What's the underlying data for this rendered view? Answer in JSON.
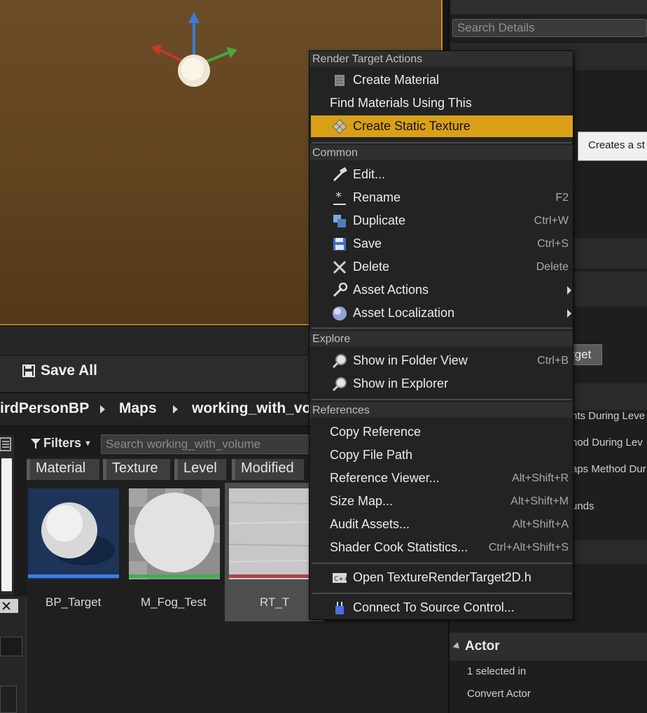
{
  "details": {
    "search_placeholder": "Search Details",
    "tooltip_text": "Creates a st",
    "partial_rows": [
      "e",
      "'",
      "nts During Leve",
      "hod During Lev",
      "aps Method Dur",
      "unds"
    ],
    "target_button": "rget",
    "actor_section": "Actor",
    "actor_selected": "1 selected in",
    "convert_actor": "Convert Actor"
  },
  "content_browser": {
    "save_all": "Save All",
    "breadcrumbs": [
      "irdPersonBP",
      "Maps",
      "working_with_vol"
    ],
    "filters_label": "Filters",
    "search_placeholder": "Search working_with_volume",
    "filter_chips": [
      "Material",
      "Texture",
      "Level",
      "Modified"
    ],
    "assets": [
      {
        "name": "BP_Target",
        "type_color": "#3d7ee6"
      },
      {
        "name": "M_Fog_Test",
        "type_color": "#3fb24a"
      },
      {
        "name": "RT_T",
        "type_color": "#b04545"
      }
    ]
  },
  "context_menu": {
    "sections": {
      "render_target": "Render Target Actions",
      "common": "Common",
      "explore": "Explore",
      "references": "References"
    },
    "render_target_items": [
      {
        "label": "Create Material",
        "icon": "material-icon"
      },
      {
        "label": "Find Materials Using This"
      },
      {
        "label": "Create Static Texture",
        "icon": "texture-icon",
        "highlighted": true
      }
    ],
    "common_items": [
      {
        "label": "Edit...",
        "icon": "edit-icon",
        "shortcut": ""
      },
      {
        "label": "Rename",
        "icon": "rename-icon",
        "shortcut": "F2"
      },
      {
        "label": "Duplicate",
        "icon": "duplicate-icon",
        "shortcut": "Ctrl+W"
      },
      {
        "label": "Save",
        "icon": "save-icon",
        "shortcut": "Ctrl+S"
      },
      {
        "label": "Delete",
        "icon": "delete-icon",
        "shortcut": "Delete"
      },
      {
        "label": "Asset Actions",
        "icon": "wrench-icon",
        "submenu": true
      },
      {
        "label": "Asset Localization",
        "icon": "globe-icon",
        "submenu": true
      }
    ],
    "explore_items": [
      {
        "label": "Show in Folder View",
        "icon": "search-icon",
        "shortcut": "Ctrl+B"
      },
      {
        "label": "Show in Explorer",
        "icon": "search-icon",
        "shortcut": ""
      }
    ],
    "reference_items": [
      {
        "label": "Copy Reference",
        "shortcut": ""
      },
      {
        "label": "Copy File Path",
        "shortcut": ""
      },
      {
        "label": "Reference Viewer...",
        "shortcut": "Alt+Shift+R"
      },
      {
        "label": "Size Map...",
        "shortcut": "Alt+Shift+M"
      },
      {
        "label": "Audit Assets...",
        "shortcut": "Alt+Shift+A"
      },
      {
        "label": "Shader Cook Statistics...",
        "shortcut": "Ctrl+Alt+Shift+S"
      }
    ],
    "open_source": {
      "label": "Open TextureRenderTarget2D.h",
      "icon": "cpp-file-icon"
    },
    "source_control": {
      "label": "Connect To Source Control...",
      "icon": "plug-icon"
    }
  },
  "colors": {
    "highlight": "#d9a017",
    "viewport_border": "#c88a24"
  }
}
